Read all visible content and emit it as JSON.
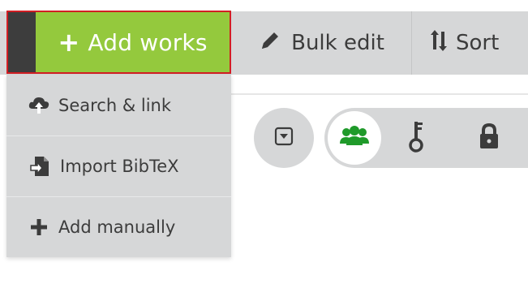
{
  "toolbar": {
    "add_works_label": "Add works",
    "bulk_edit_label": "Bulk edit",
    "sort_label": "Sort"
  },
  "add_menu": {
    "items": [
      {
        "label": "Search & link",
        "icon": "cloud-upload-icon"
      },
      {
        "label": "Import BibTeX",
        "icon": "file-import-icon"
      },
      {
        "label": "Add manually",
        "icon": "plus-icon"
      }
    ]
  },
  "visibility_filter": {
    "options": [
      "public-users-icon",
      "key-icon",
      "lock-icon"
    ],
    "selected": "public-users-icon"
  },
  "colors": {
    "accent_green": "#94c93d",
    "icon_green": "#1f9a2a",
    "highlight_border": "#d21e24",
    "toolbar_gray": "#d6d7d8"
  }
}
